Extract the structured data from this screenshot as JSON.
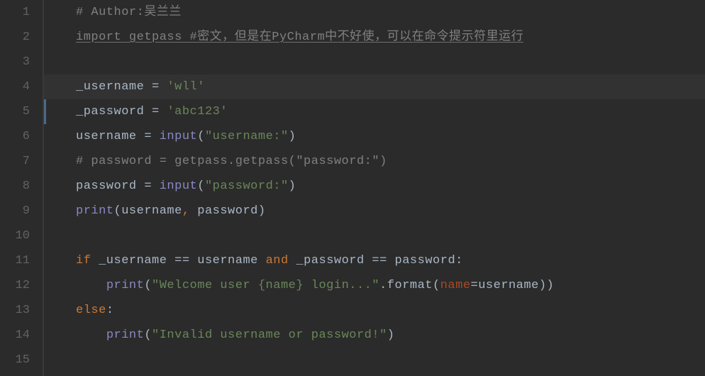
{
  "editor": {
    "line_numbers": [
      "1",
      "2",
      "3",
      "4",
      "5",
      "6",
      "7",
      "8",
      "9",
      "10",
      "11",
      "12",
      "13",
      "14",
      "15"
    ],
    "highlighted_line_index": 3,
    "lines": {
      "l1": {
        "comment": "# Author:吴兰兰"
      },
      "l2": {
        "kw_import": "import",
        "mod": " getpass ",
        "comment": "#密文，但是在PyCharm中不好使，可以在命令提示符里运行"
      },
      "l3": {},
      "l4": {
        "var": "_username ",
        "eq": "= ",
        "str": "'wll'"
      },
      "l5": {
        "var": "_password ",
        "eq": "= ",
        "str": "'abc123'"
      },
      "l6": {
        "var": "username ",
        "eq": "= ",
        "fn": "input",
        "lp": "(",
        "str": "\"username:\"",
        "rp": ")"
      },
      "l7": {
        "comment": "# password = getpass.getpass(\"password:\")"
      },
      "l8": {
        "var": "password ",
        "eq": "= ",
        "fn": "input",
        "lp": "(",
        "str": "\"password:\"",
        "rp": ")"
      },
      "l9": {
        "fn": "print",
        "lp": "(",
        "a1": "username",
        "comma": ", ",
        "a2": "password",
        "rp": ")"
      },
      "l10": {},
      "l11": {
        "kw_if": "if ",
        "v1": "_username ",
        "op1": "== ",
        "v2": "username ",
        "kw_and": "and ",
        "v3": "_password ",
        "op2": "== ",
        "v4": "password",
        "colon": ":"
      },
      "l12": {
        "indent": "    ",
        "fn": "print",
        "lp": "(",
        "str": "\"Welcome user {name} login...\"",
        "dot": ".format(",
        "kw": "name",
        "eq2": "=",
        "val": "username",
        "rp2": "))"
      },
      "l13": {
        "kw_else": "else",
        "colon": ":"
      },
      "l14": {
        "indent": "    ",
        "fn": "print",
        "lp": "(",
        "str": "\"Invalid username or password!\"",
        "rp": ")"
      },
      "l15": {}
    }
  }
}
